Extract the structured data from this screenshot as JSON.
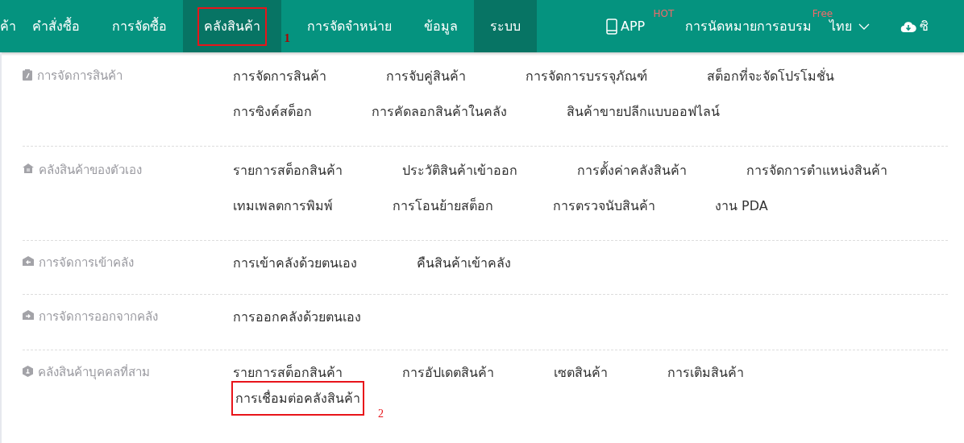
{
  "nav_items": [
    {
      "label": "ค้า",
      "selected": false
    },
    {
      "label": "คำสั่งซื้อ",
      "selected": false
    },
    {
      "label": "การจัดซื้อ",
      "selected": false
    },
    {
      "label": "คลังสินค้า",
      "selected": true,
      "annotation": "1"
    },
    {
      "label": "การจัดจำหน่าย",
      "selected": false
    },
    {
      "label": "ข้อมูล",
      "selected": false
    },
    {
      "label": "ระบบ",
      "selected": true
    }
  ],
  "nav_right": [
    {
      "kind": "app",
      "label": "APP",
      "badge": "HOT"
    },
    {
      "kind": "training",
      "label": "การนัดหมายการอบรม",
      "badge": "Free"
    },
    {
      "kind": "language",
      "label": "ไทย"
    },
    {
      "kind": "download",
      "label": "ซิ"
    }
  ],
  "groups": [
    {
      "title": "การจัดการสินค้า",
      "rows": [
        [
          {
            "label": "การจัดการสินค้า"
          },
          {
            "label": "การจับคู่สินค้า"
          },
          {
            "label": "การจัดการบรรจุภัณฑ์"
          },
          {
            "label": "สต็อกที่จะจัดโปรโมชั่น"
          }
        ],
        [
          {
            "label": "การซิงค์สต็อก"
          },
          {
            "label": "การคัดลอกสินค้าในคลัง"
          },
          {
            "label": "สินค้าขายปลีกแบบออฟไลน์"
          }
        ]
      ]
    },
    {
      "title": "คลังสินค้าของตัวเอง",
      "rows": [
        [
          {
            "label": "รายการสต็อกสินค้า"
          },
          {
            "label": "ประวัติสินค้าเข้าออก"
          },
          {
            "label": "การตั้งค่าคลังสินค้า"
          },
          {
            "label": "การจัดการตำแหน่งสินค้า"
          }
        ],
        [
          {
            "label": "เทมเพลตการพิมพ์"
          },
          {
            "label": "การโอนย้ายสต็อก"
          },
          {
            "label": "การตรวจนับสินค้า"
          },
          {
            "label": "งาน PDA"
          }
        ]
      ]
    },
    {
      "title": "การจัดการเข้าคลัง",
      "rows": [
        [
          {
            "label": "การเข้าคลังด้วยตนเอง"
          },
          {
            "label": "คืนสินค้าเข้าคลัง"
          }
        ]
      ]
    },
    {
      "title": "การจัดการออกจากคลัง",
      "rows": [
        [
          {
            "label": "การออกคลังด้วยตนเอง"
          }
        ]
      ]
    },
    {
      "title": "คลังสินค้าบุคคลที่สาม",
      "rows": [
        [
          {
            "label": "รายการสต็อกสินค้า"
          },
          {
            "label": "การอัปเดตสินค้า"
          },
          {
            "label": "เซตสินค้า"
          },
          {
            "label": "การเติมสินค้า"
          }
        ],
        [
          {
            "label": "การเชื่อมต่อคลังสินค้า",
            "annotation": "2"
          }
        ]
      ]
    }
  ]
}
